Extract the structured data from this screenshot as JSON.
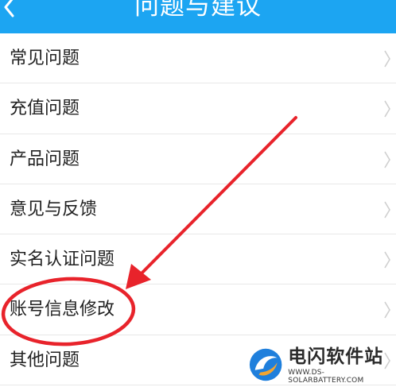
{
  "header": {
    "title": "问题与建议"
  },
  "list": {
    "items": [
      {
        "label": "常见问题"
      },
      {
        "label": "充值问题"
      },
      {
        "label": "产品问题"
      },
      {
        "label": "意见与反馈"
      },
      {
        "label": "实名认证问题"
      },
      {
        "label": "账号信息修改"
      },
      {
        "label": "其他问题"
      }
    ]
  },
  "annotation": {
    "color": "#e8232b"
  },
  "watermark": {
    "name": "电闪软件站",
    "url": "WWW.DS-SOLARBATTERY.COM"
  }
}
